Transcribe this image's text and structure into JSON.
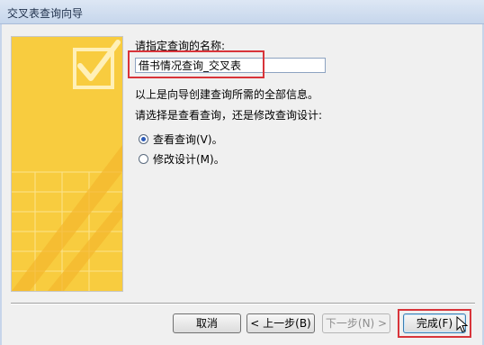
{
  "window": {
    "title": "交叉表查询向导"
  },
  "form": {
    "name_prompt": "请指定查询的名称:",
    "name_value": "借书情况查询_交叉表",
    "info_text": "以上是向导创建查询所需的全部信息。",
    "choice_prompt": "请选择是查看查询，还是修改查询设计:",
    "options": [
      {
        "label": "查看查询(V)。",
        "selected": true
      },
      {
        "label": "修改设计(M)。",
        "selected": false
      }
    ]
  },
  "buttons": {
    "cancel": "取消",
    "back": "< 上一步(B)",
    "next": "下一步(N) >",
    "finish": "完成(F)"
  },
  "colors": {
    "highlight": "#d8343a",
    "side_panel": "#f7c93a"
  }
}
